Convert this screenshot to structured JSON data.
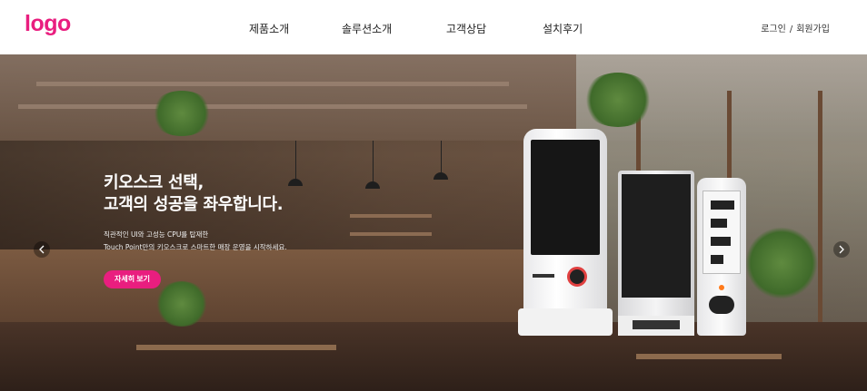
{
  "header": {
    "logo": "logo",
    "nav": [
      {
        "label": "제품소개"
      },
      {
        "label": "솔루션소개"
      },
      {
        "label": "고객상담"
      },
      {
        "label": "설치후기"
      }
    ],
    "auth": {
      "login": "로그인",
      "separator": "/",
      "signup": "회원가입"
    }
  },
  "hero": {
    "headline_line1": "키오스크 선택,",
    "headline_line2": "고객의 성공을 좌우합니다.",
    "sub_line1": "직관적인 UI와 고성능 CPU를 탑재한",
    "sub_line2": "Touch Point만의 키오스크로 스마트한 매장 운영을 시작하세요.",
    "cta_label": "자세히 보기",
    "prev_icon": "chevron-left-icon",
    "next_icon": "chevron-right-icon"
  },
  "colors": {
    "accent": "#e91e7f",
    "text_dark": "#222222",
    "header_bg": "#ffffff"
  }
}
